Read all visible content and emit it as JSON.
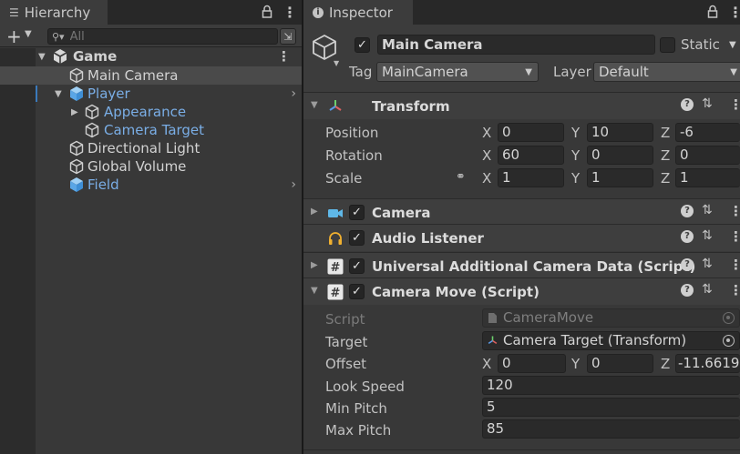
{
  "hierarchy": {
    "tab_label": "Hierarchy",
    "search_placeholder": "All",
    "items": [
      {
        "label": "Game",
        "bold": true
      },
      {
        "label": "Main Camera"
      },
      {
        "label": "Player"
      },
      {
        "label": "Appearance"
      },
      {
        "label": "Camera Target"
      },
      {
        "label": "Directional Light"
      },
      {
        "label": "Global Volume"
      },
      {
        "label": "Field"
      }
    ]
  },
  "inspector": {
    "tab_label": "Inspector",
    "object_name": "Main Camera",
    "static_label": "Static",
    "tag_label": "Tag",
    "tag_value": "MainCamera",
    "layer_label": "Layer",
    "layer_value": "Default",
    "transform": {
      "title": "Transform",
      "position_label": "Position",
      "rotation_label": "Rotation",
      "scale_label": "Scale",
      "axes": [
        "X",
        "Y",
        "Z"
      ],
      "position": [
        "0",
        "10",
        "-6"
      ],
      "rotation": [
        "60",
        "0",
        "0"
      ],
      "scale": [
        "1",
        "1",
        "1"
      ]
    },
    "components": [
      {
        "title": "Camera"
      },
      {
        "title": "Audio Listener"
      },
      {
        "title": "Universal Additional Camera Data (Script)"
      },
      {
        "title": "Camera Move (Script)"
      }
    ],
    "camera_move": {
      "script_label": "Script",
      "script_value": "CameraMove",
      "target_label": "Target",
      "target_value": "Camera Target (Transform)",
      "offset_label": "Offset",
      "offset": [
        "0",
        "0",
        "-11.6619"
      ],
      "look_speed_label": "Look Speed",
      "look_speed": "120",
      "min_pitch_label": "Min Pitch",
      "min_pitch": "5",
      "max_pitch_label": "Max Pitch",
      "max_pitch": "85"
    }
  },
  "colors": {
    "panel_bg": "#383838",
    "tab_bar": "#282828",
    "selected_row": "#4a4a4a",
    "prefab_blue": "#7aaee6",
    "field_bg": "#2a2a2a"
  }
}
